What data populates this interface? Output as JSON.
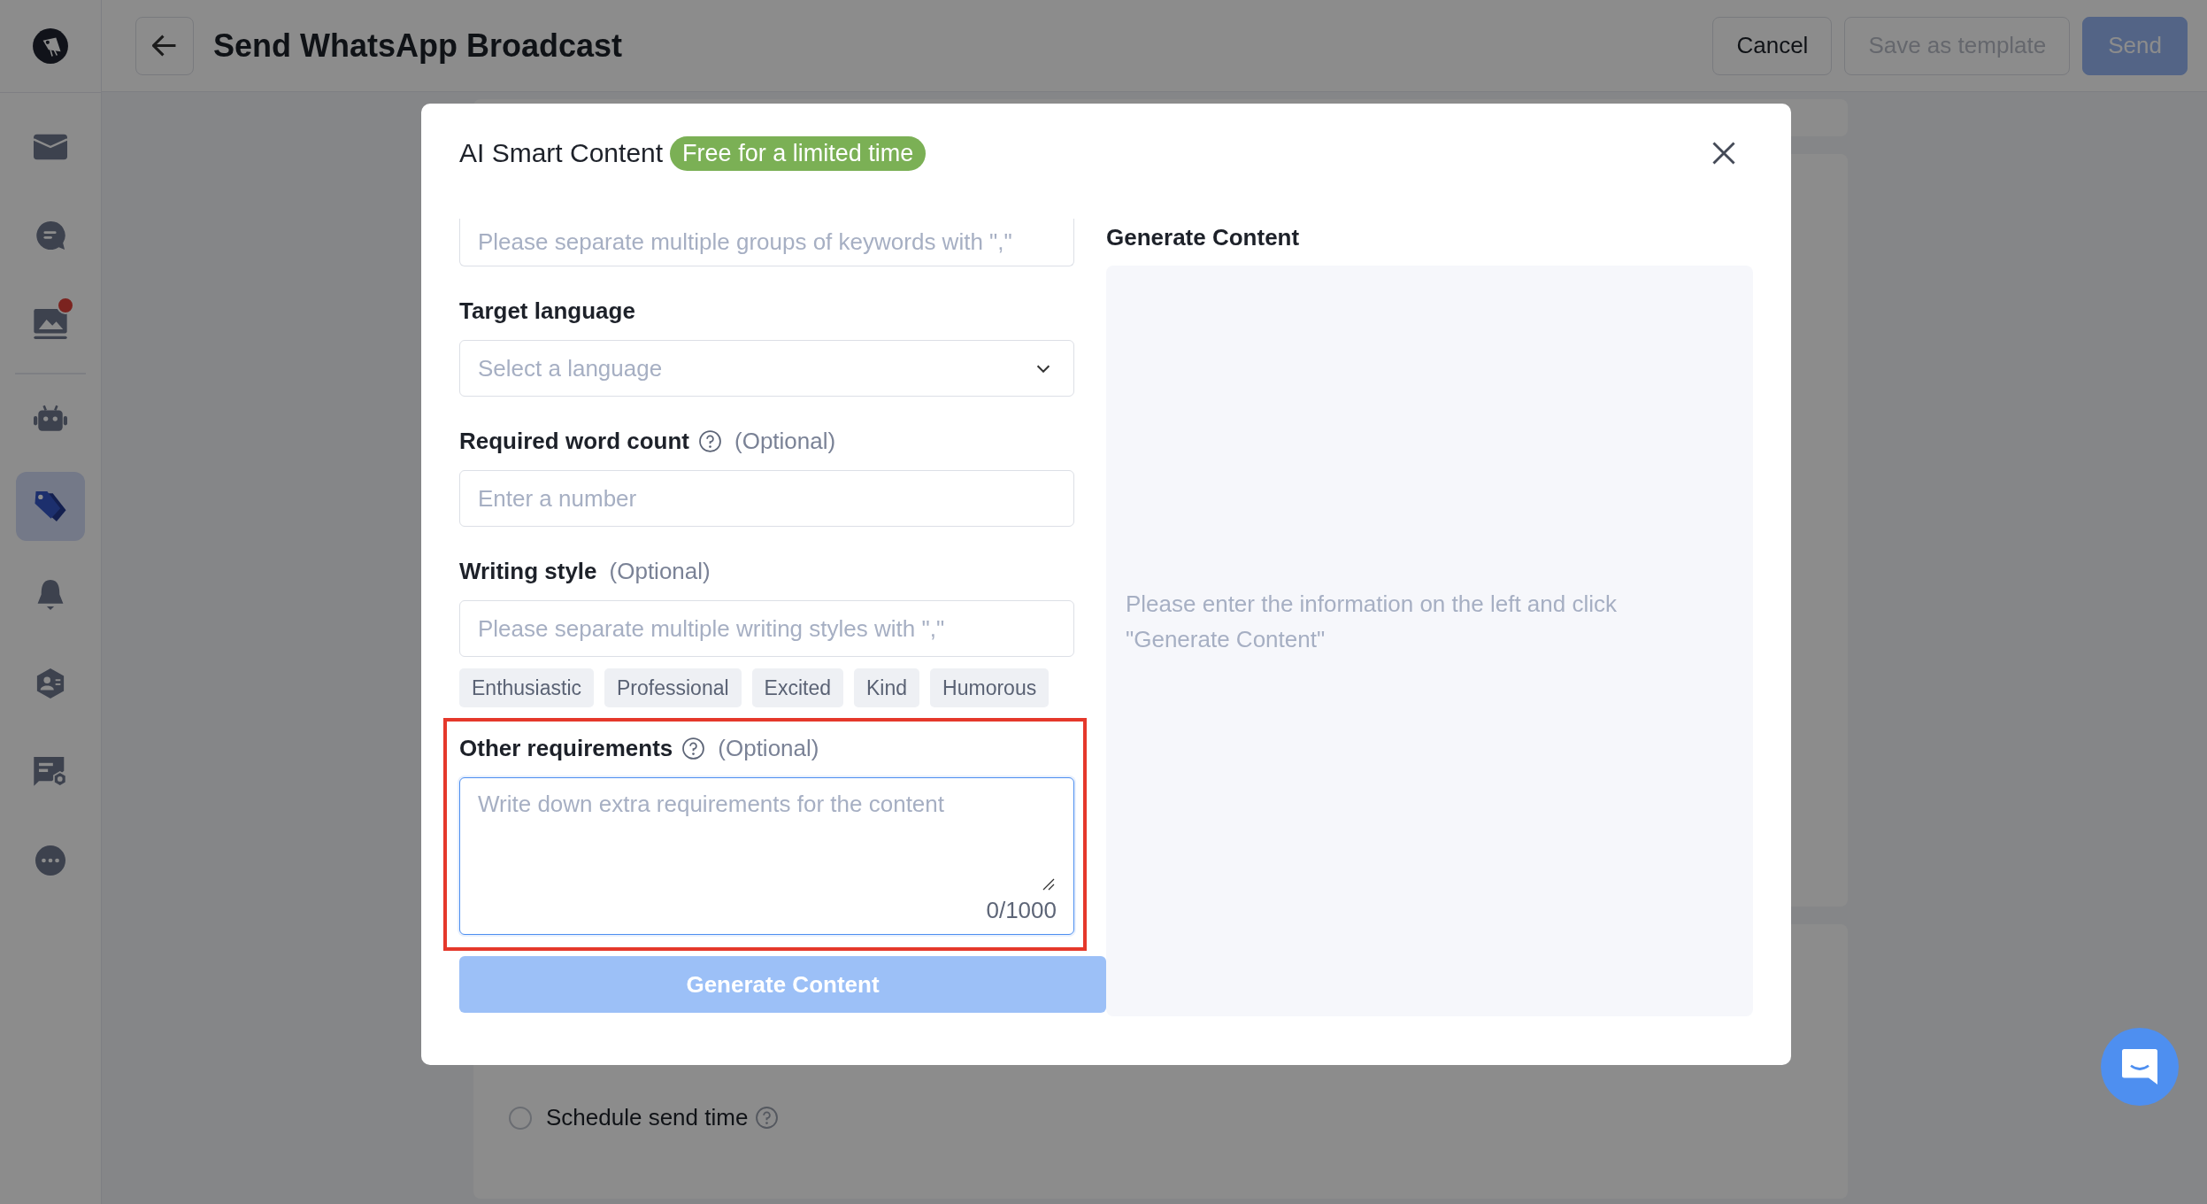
{
  "sidebar": {
    "items": [
      {
        "kind": "mail",
        "selected": false,
        "badge": false
      },
      {
        "kind": "chat",
        "selected": false,
        "badge": false
      },
      {
        "kind": "gallery",
        "selected": false,
        "badge": true
      },
      {
        "kind": "divider"
      },
      {
        "kind": "robot",
        "selected": false,
        "badge": false
      },
      {
        "kind": "tags",
        "selected": true,
        "badge": false
      },
      {
        "kind": "bell",
        "selected": false,
        "badge": false
      },
      {
        "kind": "contact",
        "selected": false,
        "badge": false
      },
      {
        "kind": "card",
        "selected": false,
        "badge": false
      },
      {
        "kind": "more",
        "selected": false,
        "badge": false
      }
    ]
  },
  "header": {
    "title": "Send WhatsApp Broadcast",
    "buttons": [
      {
        "label": "Cancel",
        "kind": "default",
        "disabled": false
      },
      {
        "label": "Save as template",
        "kind": "default",
        "disabled": true
      },
      {
        "label": "Send",
        "kind": "primary",
        "disabled": true
      }
    ]
  },
  "schedule": {
    "label": "Schedule send time",
    "selected": false
  },
  "modal": {
    "title": "AI Smart Content",
    "badge": "Free for a limited time",
    "fields": [
      {
        "kind": "input",
        "placeholder": "Please separate multiple groups of keywords with \",\""
      },
      {
        "kind": "select",
        "label": "Target language",
        "placeholder": "Select a language"
      },
      {
        "kind": "input",
        "label": "Required word count",
        "help": true,
        "optional": "(Optional)",
        "placeholder": "Enter a number"
      },
      {
        "kind": "input",
        "label": "Writing style",
        "optional": "(Optional)",
        "placeholder": "Please separate multiple writing styles with \",\"",
        "tags": [
          "Enthusiastic",
          "Professional",
          "Excited",
          "Kind",
          "Humorous"
        ]
      },
      {
        "kind": "textarea",
        "label": "Other requirements",
        "help": true,
        "optional": "(Optional)",
        "placeholder": "Write down extra requirements for the content",
        "counter": "0/1000",
        "focused": true,
        "highlighted": true
      }
    ],
    "generate_button": {
      "label": "Generate Content",
      "disabled": true
    },
    "output": {
      "title": "Generate Content",
      "placeholder": "Please enter the information on the left and click \"Generate Content\""
    }
  }
}
